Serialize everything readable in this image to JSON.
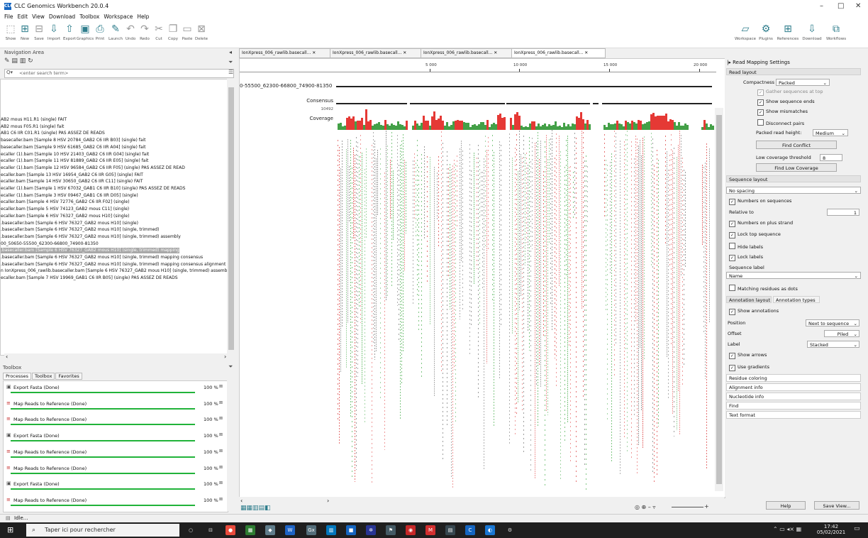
{
  "window": {
    "title": "CLC Genomics Workbench 20.0.4",
    "logo": "CLC",
    "minimize": "–",
    "maximize": "□",
    "close": "✕"
  },
  "menu": [
    "File",
    "Edit",
    "View",
    "Download",
    "Toolbox",
    "Workspace",
    "Help"
  ],
  "toolbar": {
    "left": [
      {
        "label": "Show",
        "icon": "show-icon"
      },
      {
        "label": "New",
        "icon": "new-icon"
      },
      {
        "label": "Save",
        "icon": "save-icon"
      },
      {
        "label": "Import",
        "icon": "import-icon"
      },
      {
        "label": "Export",
        "icon": "export-icon"
      },
      {
        "label": "Graphics",
        "icon": "graphics-icon"
      },
      {
        "label": "Print",
        "icon": "print-icon"
      },
      {
        "label": "Launch",
        "icon": "launch-icon"
      },
      {
        "label": "Undo",
        "icon": "undo-icon"
      },
      {
        "label": "Redo",
        "icon": "redo-icon"
      },
      {
        "label": "Cut",
        "icon": "cut-icon"
      },
      {
        "label": "Copy",
        "icon": "copy-icon"
      },
      {
        "label": "Paste",
        "icon": "paste-icon"
      },
      {
        "label": "Delete",
        "icon": "delete-icon"
      }
    ],
    "right": [
      {
        "label": "Workspace",
        "icon": "workspace-icon"
      },
      {
        "label": "Plugins",
        "icon": "plugins-icon"
      },
      {
        "label": "References",
        "icon": "references-icon"
      },
      {
        "label": "Download",
        "icon": "download-icon"
      },
      {
        "label": "Workflows",
        "icon": "workflows-icon"
      }
    ]
  },
  "navigation": {
    "header": "Navigation Area",
    "search_placeholder": "<enter search term>",
    "items": [
      {
        "text": "AB2 mous H11.R1 (single) FAIT",
        "selected": false
      },
      {
        "text": "AB2 mous F05.R1 (single) fait",
        "selected": false
      },
      {
        "text": "AB1 C6 IIR C01.R1 (single) PAS ASSEZ DE READS",
        "selected": false
      },
      {
        "text": "basecaller.bam [Sample 8 HSV 20784_GAB2 C6 IIR B03] (single) fait",
        "selected": false
      },
      {
        "text": "basecaller.bam [Sample 9 HSV 61685_GAB2 C6 IIR A04] (single) fait",
        "selected": false
      },
      {
        "text": "ecaller (1).bam [Sample 10 HSV 21403_GAB2 C6 IIR G04] (single) fait",
        "selected": false
      },
      {
        "text": "ecaller (1).bam [Sample 11 HSV 81889_GAB2 C6 IIR E05] (single) fait",
        "selected": false
      },
      {
        "text": "ecaller (1).bam [Sample 12 HSV 96584_GAB2 C6 IIR F05] (single) PAS ASSEZ DE READ",
        "selected": false
      },
      {
        "text": "ecaller.bam [Sample 13 HSV 16954_GAB2 C6 IIR G05] (single) FAIT",
        "selected": false
      },
      {
        "text": "ecaller.bam [Sample 14 HSV 30650_GAB2 C6 IIR C11] (single) FAIT",
        "selected": false
      },
      {
        "text": "ecaller (1).bam [Sample 1 HSV 67032_GAB1 C6 IIR B10] (single) PAS ASSEZ DE READS",
        "selected": false
      },
      {
        "text": "ecaller (1).bam [Sample 3 HSV 09467_GAB1 C6 IIR D05] (single)",
        "selected": false
      },
      {
        "text": "ecaller.bam [Sample 4 HSV 72776_GAB2 C6 IIR F02] (single)",
        "selected": false
      },
      {
        "text": "ecaller.bam [Sample 5 HSV 74123_GAB2 mous C11] (single)",
        "selected": false
      },
      {
        "text": "ecaller.bam [Sample 6 HSV 76327_GAB2 mous H10] (single)",
        "selected": false
      },
      {
        "text": ".basecaller.bam [Sample 6 HSV 76327_GAB2 mous H10] (single)",
        "selected": false
      },
      {
        "text": ".basecaller.bam [Sample 6 HSV 76327_GAB2 mous H10] (single, trimmed)",
        "selected": false
      },
      {
        "text": ".basecaller.bam [Sample 6 HSV 76327_GAB2 mous H10] (single, trimmed) assembly",
        "selected": false
      },
      {
        "text": "00_50650-55500_62300-66800_74900-81350",
        "selected": false
      },
      {
        "text": ".basecaller.bam [Sample 6 HSV 76327_GAB2 mous H10] (single, trimmed) mapping",
        "selected": true
      },
      {
        "text": ".basecaller.bam [Sample 6 HSV 76327_GAB2 mous H10] (single, trimmed) mapping consensus",
        "selected": false
      },
      {
        "text": ".basecaller.bam [Sample 6 HSV 76327_GAB2 mous H10] (single, trimmed) mapping consensus alignment",
        "selected": false
      },
      {
        "text": "n IonXpress_006_rawlib.basecaller.bam [Sample 6 HSV 76327_GAB2 mous H10] (single, trimmed) assemb",
        "selected": false
      },
      {
        "text": "ecaller.bam [Sample 7 HSV 19969_GAB1 C6 IIR B05] (single) PAS ASSEZ DE READS",
        "selected": false
      }
    ]
  },
  "toolbox": {
    "header": "Toolbox",
    "tabs": [
      {
        "label": "Processes",
        "active": true
      },
      {
        "label": "Toolbox",
        "active": false
      },
      {
        "label": "Favorites",
        "active": false
      }
    ],
    "processes": [
      {
        "name": "Export Fasta (Done)",
        "percent": "100 %",
        "progress": 1.0,
        "icon": "export-icon"
      },
      {
        "name": "Map Reads to Reference (Done)",
        "percent": "100 %",
        "progress": 1.0,
        "icon": "map-reads-icon"
      },
      {
        "name": "Map Reads to Reference (Done)",
        "percent": "100 %",
        "progress": 1.0,
        "icon": "map-reads-icon"
      },
      {
        "name": "Export Fasta (Done)",
        "percent": "100 %",
        "progress": 1.0,
        "icon": "export-icon"
      },
      {
        "name": "Map Reads to Reference (Done)",
        "percent": "100 %",
        "progress": 1.0,
        "icon": "map-reads-icon"
      },
      {
        "name": "Map Reads to Reference (Done)",
        "percent": "100 %",
        "progress": 1.0,
        "icon": "map-reads-icon"
      },
      {
        "name": "Export Fasta (Done)",
        "percent": "100 %",
        "progress": 1.0,
        "icon": "export-icon"
      },
      {
        "name": "Map Reads to Reference (Done)",
        "percent": "100 %",
        "progress": 1.0,
        "icon": "map-reads-icon"
      }
    ]
  },
  "editor": {
    "tabs": [
      {
        "label": "IonXpress_006_rawlib.basecall...",
        "active": false
      },
      {
        "label": "IonXpress_006_rawlib.basecall...",
        "active": false
      },
      {
        "label": "IonXpress_006_rawlib.basecall...",
        "active": false
      },
      {
        "label": "IonXpress_006_rawlib.basecall...",
        "active": true
      }
    ],
    "ruler": [
      "5 000",
      "10 000",
      "15 000",
      "20 000"
    ],
    "reference_name": "0-55500_62300-66800_74900-81350",
    "consensus_label": "Consensus",
    "coverage_max": "10492",
    "coverage_label": "Coverage"
  },
  "settings": {
    "title": "Read Mapping Settings",
    "read_layout": {
      "header": "Read layout",
      "compactness_label": "Compactness",
      "compactness_value": "Packed",
      "gather": {
        "label": "Gather sequences at top",
        "checked": true,
        "disabled": true
      },
      "show_ends": {
        "label": "Show sequence ends",
        "checked": true
      },
      "show_mismatches": {
        "label": "Show mismatches",
        "checked": true
      },
      "disconnect_pairs": {
        "label": "Disconnect pairs",
        "checked": false
      },
      "packed_height_label": "Packed read height:",
      "packed_height_value": "Medium",
      "find_conflict": "Find Conflict",
      "low_cov_label": "Low coverage threshold",
      "low_cov_value": "8",
      "find_low_cov": "Find Low Coverage"
    },
    "sequence_layout": {
      "header": "Sequence layout",
      "spacing": "No spacing",
      "numbers_on_sequences": {
        "label": "Numbers on sequences",
        "checked": true
      },
      "relative_to_label": "Relative to",
      "relative_to_value": "1",
      "numbers_plus": {
        "label": "Numbers on plus strand",
        "checked": true
      },
      "lock_top": {
        "label": "Lock top sequence",
        "checked": true
      },
      "hide_labels": {
        "label": "Hide labels",
        "checked": false
      },
      "lock_labels": {
        "label": "Lock labels",
        "checked": true
      },
      "seq_label_label": "Sequence label",
      "seq_label_value": "Name",
      "matching_dots": {
        "label": "Matching residues as dots",
        "checked": false
      }
    },
    "annotation_layout": {
      "tabs": [
        "Annotation layout",
        "Annotation types"
      ],
      "show_annotations": {
        "label": "Show annotations",
        "checked": true
      },
      "position_label": "Position",
      "position_value": "Next to sequence",
      "offset_label": "Offset",
      "offset_value": "Piled",
      "label_label": "Label",
      "label_value": "Stacked",
      "show_arrows": {
        "label": "Show arrows",
        "checked": true
      },
      "use_gradients": {
        "label": "Use gradients",
        "checked": true
      }
    },
    "collapsed": [
      "Residue coloring",
      "Alignment info",
      "Nucleotide info",
      "Find",
      "Text format"
    ],
    "help_button": "Help",
    "save_view_button": "Save View..."
  },
  "status": "Idle...",
  "taskbar": {
    "search_placeholder": "Taper ici pour rechercher",
    "time": "17:42",
    "date": "05/02/2021"
  },
  "colors": {
    "coverage_red": "#e53935",
    "coverage_green": "#43a047",
    "progress_green": "#21b33a",
    "selected_item": "#a8a8a8"
  }
}
